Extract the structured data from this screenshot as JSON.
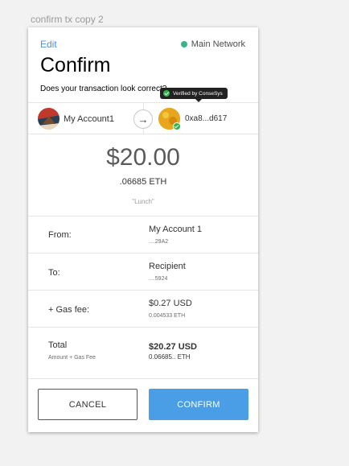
{
  "artboard_label": "confirm tx copy 2",
  "header": {
    "edit_label": "Edit",
    "network_label": "Main Network",
    "network_color": "#38b48a",
    "title": "Confirm",
    "subtitle": "Does your transaction look correct?"
  },
  "accounts": {
    "from_name": "My Account1",
    "to_address": "0xa8...d617",
    "verified_tooltip": "Verified by ConseSys",
    "verified_color": "#2fb44a"
  },
  "amount": {
    "fiat": "$20.00",
    "eth": ".06685 ETH",
    "memo": "\"Lunch\""
  },
  "details": {
    "from_label": "From:",
    "from_value": "My Account 1",
    "from_sub": "....29A2",
    "to_label": "To:",
    "to_value": "Recipient",
    "to_sub": "....5924",
    "gas_label": "+ Gas fee:",
    "gas_value": "$0.27 USD",
    "gas_sub": "0.004533 ETH",
    "total_label": "Total",
    "total_sub_label": "Amount + Gas Fee",
    "total_value": "$20.27 USD",
    "total_sub": "0.06685.. ETH"
  },
  "buttons": {
    "cancel": "CANCEL",
    "confirm": "CONFIRM",
    "confirm_color": "#4a9ee6"
  }
}
